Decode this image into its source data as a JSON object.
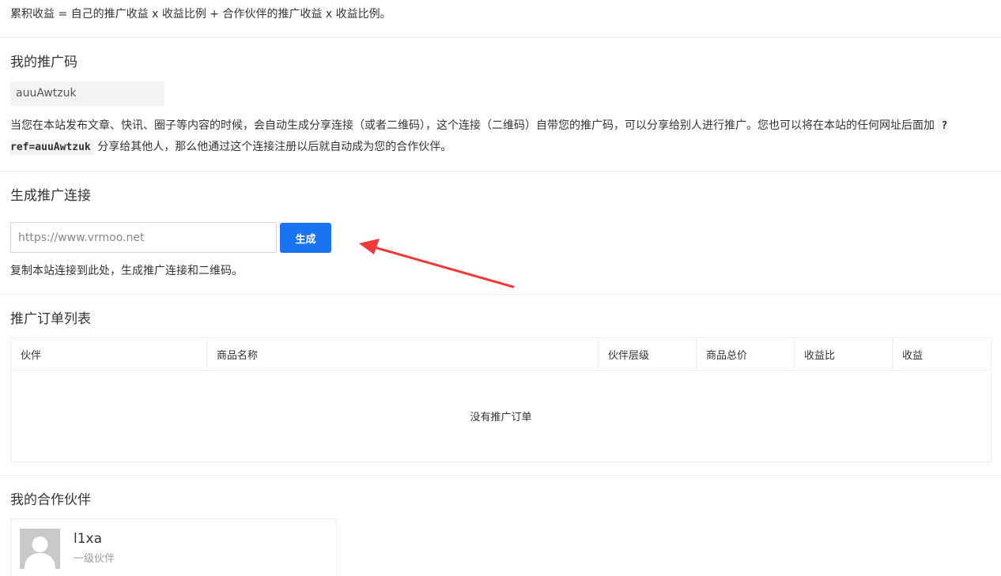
{
  "formula": {
    "text": "累积收益 = 自己的推广收益 x 收益比例 + 合作伙伴的推广收益 x 收益比例。"
  },
  "promo_code": {
    "title": "我的推广码",
    "code": "auuAwtzuk",
    "desc_before": "当您在本站发布文章、快讯、圈子等内容的时候，会自动生成分享连接（或者二维码），这个连接（二维码）自带您的推广码，可以分享给别人进行推广。您也可以将在本站的任何网址后面加",
    "ref_param": "?ref=auuAwtzuk",
    "desc_after": "分享给其他人，那么他通过这个连接注册以后就自动成为您的合作伙伴。"
  },
  "generate_link": {
    "title": "生成推广连接",
    "input_placeholder": "https://www.vrmoo.net",
    "button_label": "生成",
    "hint": "复制本站连接到此处，生成推广连接和二维码。",
    "arrow_color": "#f03a3a"
  },
  "orders": {
    "title": "推广订单列表",
    "columns": [
      "伙伴",
      "商品名称",
      "伙伴层级",
      "商品总价",
      "收益比",
      "收益"
    ],
    "empty_text": "没有推广订单"
  },
  "partners": {
    "title": "我的合作伙伴",
    "items": [
      {
        "name": "l1xa",
        "level": "一级伙伴"
      }
    ]
  },
  "colors": {
    "accent": "#1a73f0",
    "divider": "#eeeeee"
  }
}
